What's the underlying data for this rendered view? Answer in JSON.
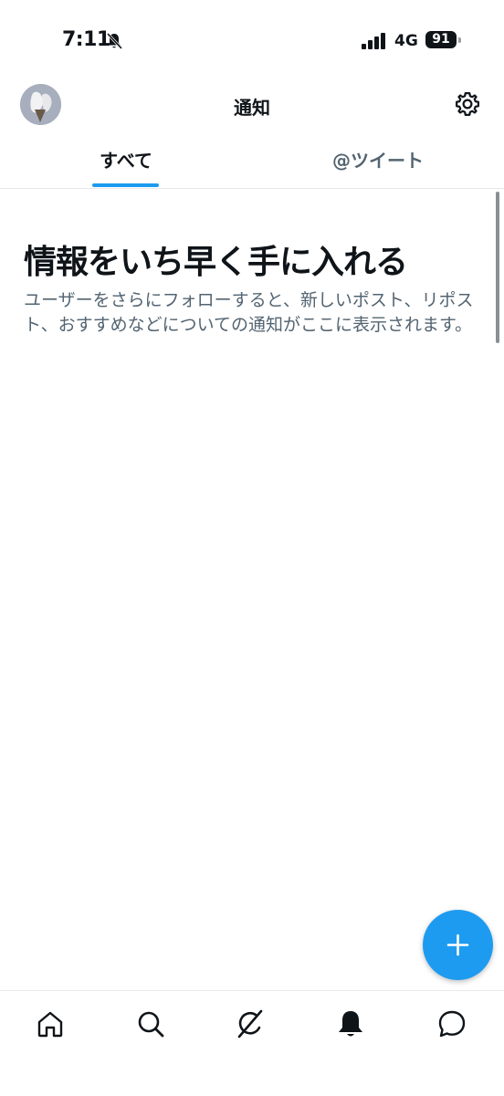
{
  "status_bar": {
    "time": "7:11",
    "network": "4G",
    "battery": "91"
  },
  "header": {
    "title": "通知"
  },
  "tabs": [
    {
      "label": "すべて",
      "active": true
    },
    {
      "label": "@ツイート",
      "active": false
    }
  ],
  "empty_state": {
    "title": "情報をいち早く手に入れる",
    "body": "ユーザーをさらにフォローすると、新しいポスト、リポスト、おすすめなどについての通知がここに表示されます。"
  },
  "colors": {
    "accent": "#1d9bf0",
    "text": "#0f1419",
    "secondary": "#536471"
  },
  "icons": {
    "status": [
      "bell-off-icon",
      "signal-icon",
      "battery-icon"
    ],
    "header": [
      "avatar",
      "gear-icon"
    ],
    "fab": "plus-icon",
    "nav": [
      "home-icon",
      "search-icon",
      "grok-icon",
      "bell-icon",
      "message-icon"
    ]
  }
}
